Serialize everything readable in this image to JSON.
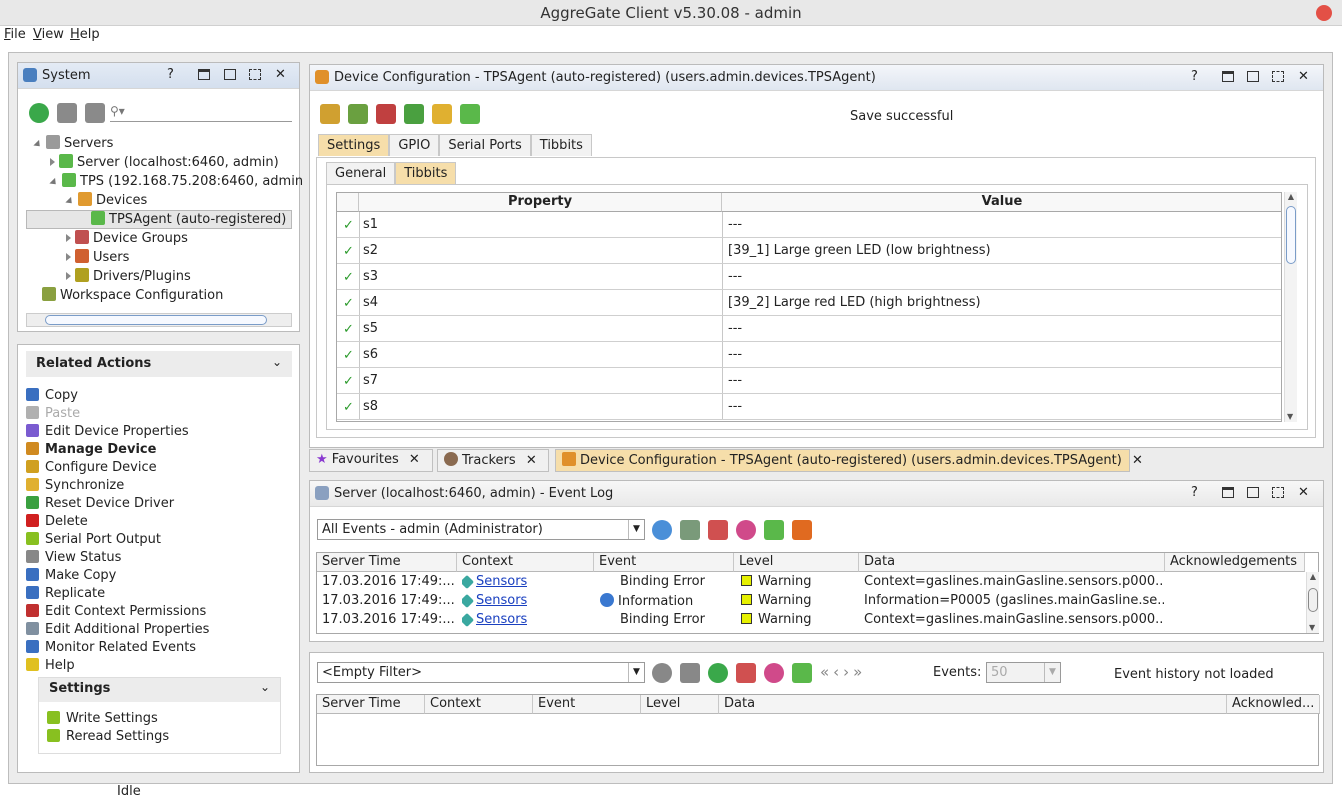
{
  "window": {
    "title": "AggreGate Client v5.30.08 - admin"
  },
  "menu": [
    {
      "label": "File",
      "u": "F",
      "rest": "ile"
    },
    {
      "label": "View",
      "u": "V",
      "rest": "iew"
    },
    {
      "label": "Help",
      "u": "H",
      "rest": "elp"
    }
  ],
  "system": {
    "title": "System",
    "help": "?",
    "search_placeholder": "",
    "tree": [
      {
        "label": "Servers"
      },
      {
        "label": "Server (localhost:6460, admin)"
      },
      {
        "label": "TPS (192.168.75.208:6460, admin"
      },
      {
        "label": "Devices"
      },
      {
        "label": "TPSAgent (auto-registered)"
      },
      {
        "label": "Device Groups"
      },
      {
        "label": "Users"
      },
      {
        "label": "Drivers/Plugins"
      },
      {
        "label": "Workspace Configuration"
      }
    ]
  },
  "related": {
    "title": "Related Actions",
    "actions": [
      {
        "label": "Copy",
        "color": "#3a6fc0"
      },
      {
        "label": "Paste",
        "color": "#b0b0b0"
      },
      {
        "label": "Edit Device Properties",
        "color": "#7a5bd0"
      },
      {
        "label": "Manage Device",
        "color": "#d08a20"
      },
      {
        "label": "Configure Device",
        "color": "#d0a020"
      },
      {
        "label": "Synchronize",
        "color": "#e0b030"
      },
      {
        "label": "Reset Device Driver",
        "color": "#3aa040"
      },
      {
        "label": "Delete",
        "color": "#d02020"
      },
      {
        "label": "Serial Port Output",
        "color": "#88c020"
      },
      {
        "label": "View Status",
        "color": "#888888"
      },
      {
        "label": "Make Copy",
        "color": "#3a6fc0"
      },
      {
        "label": "Replicate",
        "color": "#3a6fc0"
      },
      {
        "label": "Edit Context Permissions",
        "color": "#c03030"
      },
      {
        "label": "Edit Additional Properties",
        "color": "#8090a0"
      },
      {
        "label": "Monitor Related Events",
        "color": "#3a6fc0"
      },
      {
        "label": "Help",
        "color": "#e0c020"
      }
    ],
    "settings_title": "Settings",
    "settings": [
      {
        "label": "Write Settings"
      },
      {
        "label": "Reread Settings"
      }
    ]
  },
  "config": {
    "title": "Device Configuration - TPSAgent (auto-registered) (users.admin.devices.TPSAgent)",
    "status": "Save successful",
    "tabs": [
      "Settings",
      "GPIO",
      "Serial Ports",
      "Tibbits"
    ],
    "subtabs": [
      "General",
      "Tibbits"
    ],
    "headers": {
      "property": "Property",
      "value": "Value"
    },
    "rows": [
      {
        "prop": "s1",
        "value": "---"
      },
      {
        "prop": "s2",
        "value": "[39_1] Large green LED (low brightness)"
      },
      {
        "prop": "s3",
        "value": "---"
      },
      {
        "prop": "s4",
        "value": "[39_2] Large red LED (high brightness)"
      },
      {
        "prop": "s5",
        "value": "---"
      },
      {
        "prop": "s6",
        "value": "---"
      },
      {
        "prop": "s7",
        "value": "---"
      },
      {
        "prop": "s8",
        "value": "---"
      }
    ]
  },
  "bottom_tabs": [
    {
      "label": "Favourites"
    },
    {
      "label": "Trackers"
    },
    {
      "label": "Device Configuration - TPSAgent (auto-registered) (users.admin.devices.TPSAgent)"
    }
  ],
  "eventlog": {
    "title": "Server (localhost:6460, admin) - Event Log",
    "filter": "All Events - admin (Administrator)",
    "headers": [
      "Server Time",
      "Context",
      "Event",
      "Level",
      "Data",
      "Acknowledgements"
    ],
    "rows": [
      {
        "time": "17.03.2016 17:49:...",
        "context": "Sensors",
        "event": "Binding Error",
        "level": "Warning",
        "data": "Context=gaslines.mainGasline.sensors.p000..."
      },
      {
        "time": "17.03.2016 17:49:...",
        "context": "Sensors",
        "event": "Information",
        "level": "Warning",
        "data": "Information=P0005 (gaslines.mainGasline.se..."
      },
      {
        "time": "17.03.2016 17:49:...",
        "context": "Sensors",
        "event": "Binding Error",
        "level": "Warning",
        "data": "Context=gaslines.mainGasline.sensors.p000..."
      }
    ]
  },
  "history": {
    "filter": "<Empty Filter>",
    "events_label": "Events:",
    "events_value": "50",
    "status": "Event history not loaded",
    "headers": [
      "Server Time",
      "Context",
      "Event",
      "Level",
      "Data",
      "Acknowled..."
    ]
  },
  "statusbar": {
    "text": "Idle"
  }
}
